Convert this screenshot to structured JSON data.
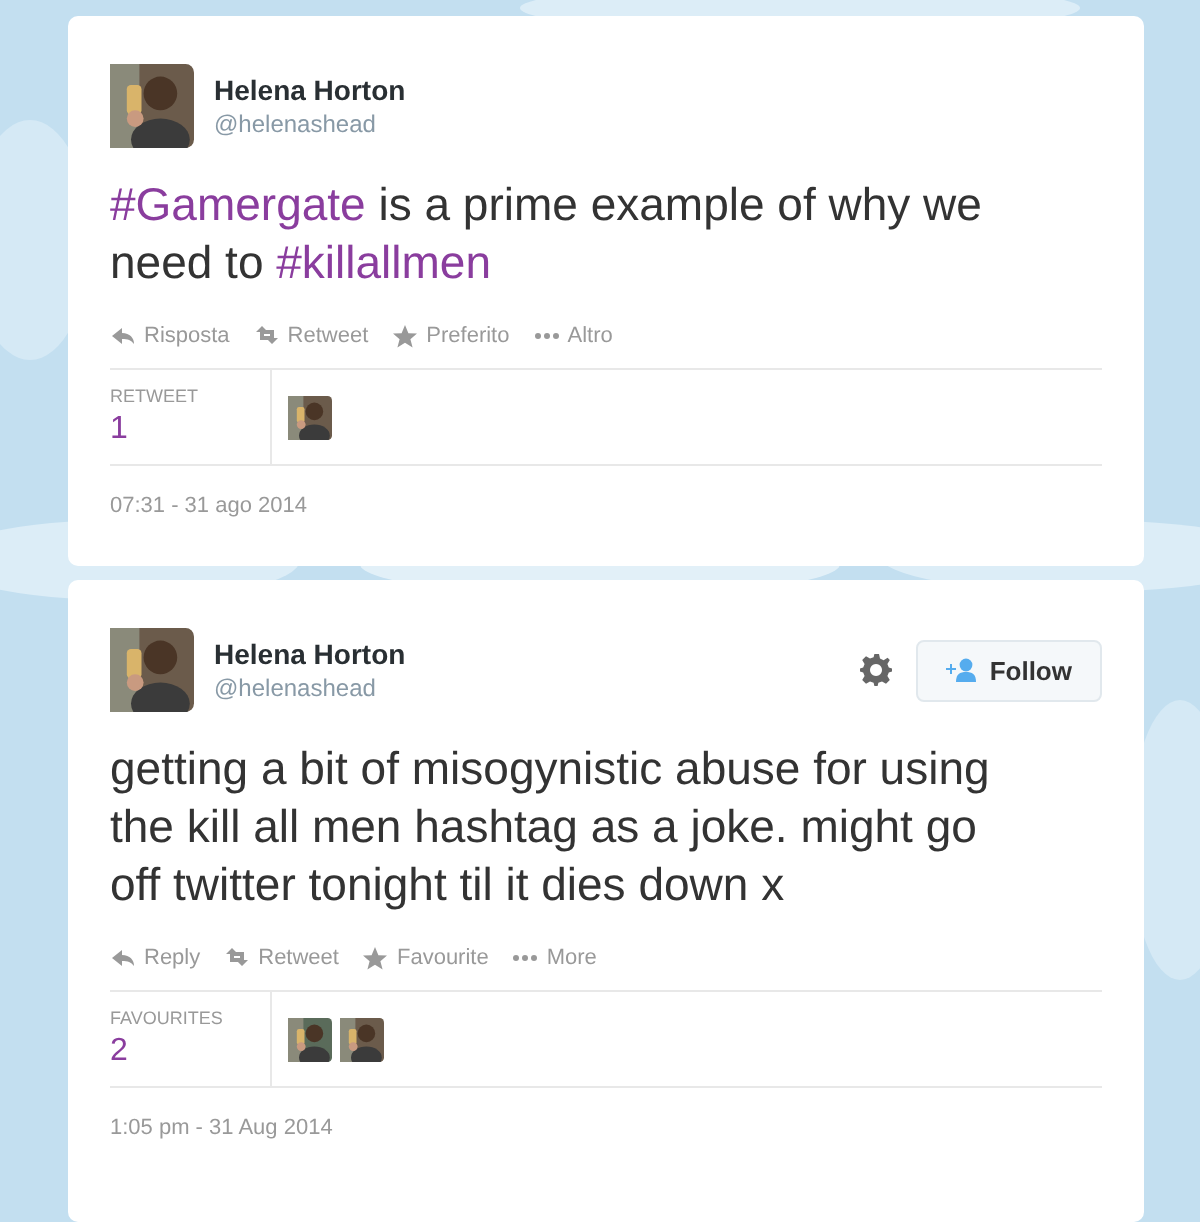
{
  "tweets": [
    {
      "name": "Helena Horton",
      "handle": "@helenashead",
      "text": [
        {
          "kind": "hashtag",
          "text": "#Gamergate"
        },
        {
          "kind": "text",
          "text": " is a prime example of why we need to "
        },
        {
          "kind": "hashtag",
          "text": "#killallmen"
        }
      ],
      "actions": [
        {
          "kind": "reply",
          "label": "Risposta"
        },
        {
          "kind": "retweet",
          "label": "Retweet"
        },
        {
          "kind": "favorite",
          "label": "Preferito"
        },
        {
          "kind": "more",
          "label": "Altro"
        }
      ],
      "stat": {
        "label": "RETWEET",
        "count": "1"
      },
      "timestamp": "07:31 - 31 ago 2014"
    },
    {
      "name": "Helena Horton",
      "handle": "@helenashead",
      "settings_menu": true,
      "follow_button": {
        "label": "Follow"
      },
      "text": [
        {
          "kind": "text",
          "text": "getting a bit of misogynistic abuse for using the kill all men hashtag as a joke. might go off twitter tonight til it dies down x"
        }
      ],
      "actions": [
        {
          "kind": "reply",
          "label": "Reply"
        },
        {
          "kind": "retweet",
          "label": "Retweet"
        },
        {
          "kind": "favorite",
          "label": "Favourite"
        },
        {
          "kind": "more",
          "label": "More"
        }
      ],
      "stat": {
        "label": "FAVOURITES",
        "count": "2"
      },
      "timestamp": "1:05 pm - 31 Aug 2014"
    }
  ]
}
